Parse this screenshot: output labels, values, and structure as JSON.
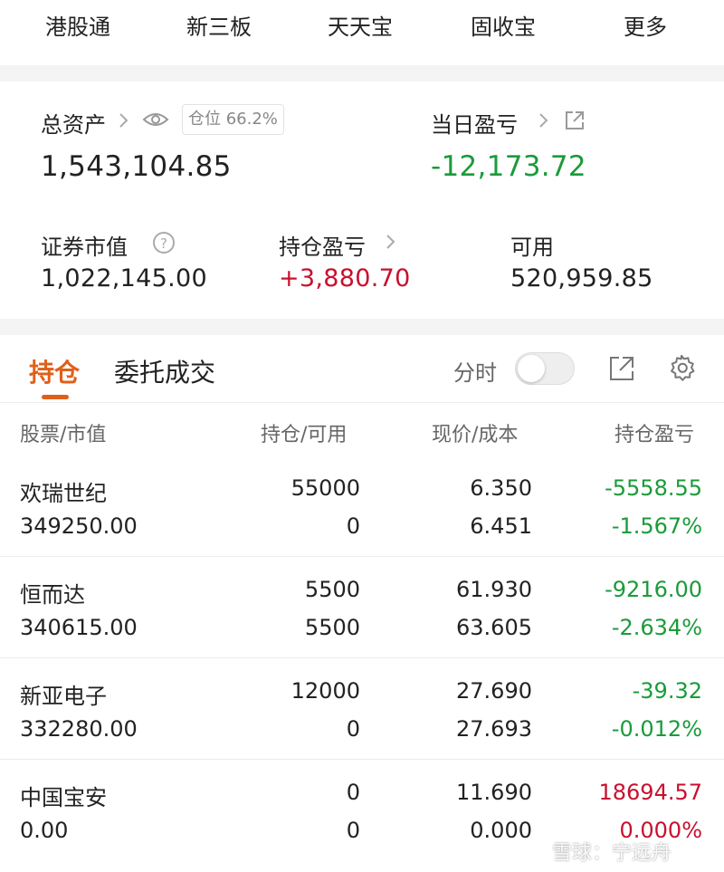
{
  "top_nav": [
    "港股通",
    "新三板",
    "天天宝",
    "固收宝",
    "更多"
  ],
  "assets": {
    "total_label": "总资产",
    "position_badge": "仓位 66.2%",
    "total_value": "1,543,104.85",
    "daily_pnl_label": "当日盈亏",
    "daily_pnl_value": "-12,173.72",
    "market_value_label": "证券市值",
    "market_value": "1,022,145.00",
    "holding_pnl_label": "持仓盈亏",
    "holding_pnl_value": "+3,880.70",
    "available_label": "可用",
    "available_value": "520,959.85"
  },
  "tabs": {
    "holdings": "持仓",
    "orders": "委托成交"
  },
  "fenshi_label": "分时",
  "fenshi_toggle_on": false,
  "columns": [
    "股票/市值",
    "持仓/可用",
    "现价/成本",
    "持仓盈亏"
  ],
  "holdings": [
    {
      "name": "欢瑞世纪",
      "market_value": "349250.00",
      "position": "55000",
      "available": "0",
      "price": "6.350",
      "cost": "6.451",
      "pnl": "-5558.55",
      "pnl_pct": "-1.567%",
      "pnl_color": "#1a9b3a"
    },
    {
      "name": "恒而达",
      "market_value": "340615.00",
      "position": "5500",
      "available": "5500",
      "price": "61.930",
      "cost": "63.605",
      "pnl": "-9216.00",
      "pnl_pct": "-2.634%",
      "pnl_color": "#1a9b3a"
    },
    {
      "name": "新亚电子",
      "market_value": "332280.00",
      "position": "12000",
      "available": "0",
      "price": "27.690",
      "cost": "27.693",
      "pnl": "-39.32",
      "pnl_pct": "-0.012%",
      "pnl_color": "#1a9b3a"
    },
    {
      "name": "中国宝安",
      "market_value": "0.00",
      "position": "0",
      "available": "0",
      "price": "11.690",
      "cost": "0.000",
      "pnl": "18694.57",
      "pnl_pct": "0.000%",
      "pnl_color": "#c8102e"
    }
  ],
  "watermark": "雪球：宁远舟",
  "colors": {
    "accent": "#e0601a",
    "loss_green": "#1a9b3a",
    "gain_red": "#c8102e"
  }
}
